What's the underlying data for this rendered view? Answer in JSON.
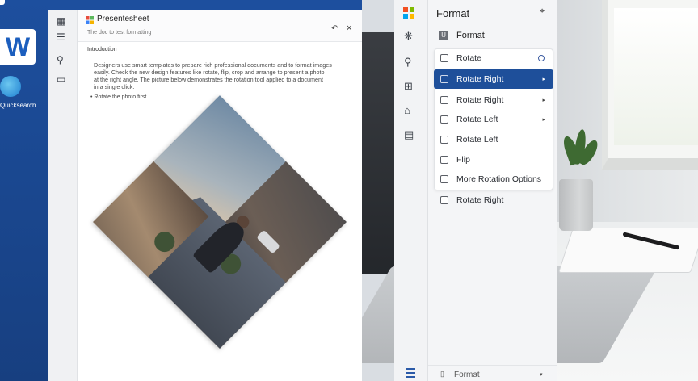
{
  "desktop": {
    "word_icon_glyph": "W",
    "label": "Quicksearch"
  },
  "word": {
    "doc_title": "Presentesheet",
    "doc_subtitle": "The doc to test formatting",
    "para_head": "Introduction",
    "para_lines": [
      "Designers use smart templates to prepare rich professional documents and to format images",
      "easily. Check the new design features like rotate, flip, crop and arrange to present a photo",
      "at the right angle. The picture below demonstrates the rotation tool applied to a document",
      "in a single click."
    ],
    "para_foot": "• Rotate the photo first",
    "header_buttons": [
      "↶",
      "✕"
    ]
  },
  "panel": {
    "title": "Format",
    "subtitle": "Format",
    "items": [
      {
        "label": "Rotate",
        "state": "normal",
        "indicator": "ring"
      },
      {
        "label": "Rotate Right",
        "state": "selected",
        "indicator": "arrow"
      },
      {
        "label": "Rotate Right",
        "state": "normal",
        "indicator": "arrow"
      },
      {
        "label": "Rotate Left",
        "state": "normal",
        "indicator": "arrow"
      },
      {
        "label": "Rotate Left",
        "state": "normal",
        "indicator": "none"
      },
      {
        "label": "Flip",
        "state": "normal",
        "indicator": "none"
      },
      {
        "label": "More Rotation Options",
        "state": "normal",
        "indicator": "none"
      }
    ],
    "extra_item": "Rotate Right",
    "bottom_label": "Format"
  },
  "colors": {
    "accent": "#1e4f9a",
    "desktop_blue": "#1d4f9e"
  },
  "icons": {
    "close": "✕",
    "arrow": "▸"
  }
}
